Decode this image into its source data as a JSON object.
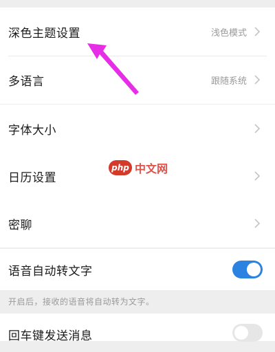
{
  "settings": {
    "dark_theme": {
      "label": "深色主题设置",
      "value": "浅色模式"
    },
    "language": {
      "label": "多语言",
      "value": "跟随系统"
    },
    "font_size": {
      "label": "字体大小"
    },
    "calendar": {
      "label": "日历设置"
    },
    "secret_chat": {
      "label": "密聊"
    },
    "voice_to_text": {
      "label": "语音自动转文字",
      "enabled": true,
      "hint": "开启后，接收的语音将自动转为文字。"
    },
    "next_item": {
      "label": "回车键发送消息",
      "enabled": false
    }
  },
  "watermark": {
    "badge": "php",
    "text": "中文网"
  },
  "colors": {
    "toggle_on": "#2c82e0",
    "annotation_arrow": "#e62ee6",
    "background": "#eeeeef"
  },
  "icons": {
    "chevron": "chevron-right-icon"
  }
}
